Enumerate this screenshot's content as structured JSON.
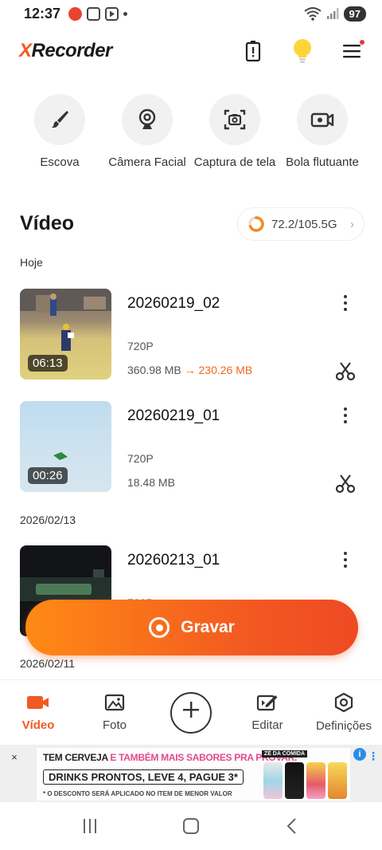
{
  "status_bar": {
    "time": "12:37",
    "battery": "97",
    "icons": [
      "notification-app-icon",
      "gallery-icon",
      "play-store-icon",
      "dot-icon",
      "wifi-icon",
      "signal-icon"
    ]
  },
  "header": {
    "logo_x": "X",
    "logo_rest": "Recorder",
    "brand_color": "#f15a22"
  },
  "tools": [
    {
      "label": "Escova",
      "icon": "brush-icon"
    },
    {
      "label": "Câmera Facial",
      "icon": "webcam-icon"
    },
    {
      "label": "Captura de tela",
      "icon": "screenshot-icon"
    },
    {
      "label": "Bola flutuante",
      "icon": "floating-ball-icon"
    }
  ],
  "section": {
    "title": "Vídeo",
    "storage": "72.2/105.5G",
    "storage_used_fraction": 0.684
  },
  "groups": [
    {
      "date": "Hoje"
    },
    {
      "date": "2026/02/13"
    },
    {
      "date": "2026/02/11"
    }
  ],
  "videos": [
    {
      "title": "20260219_02",
      "resolution": "720P",
      "size": "360.98 MB",
      "arrow": "→",
      "compressed": "230.26 MB",
      "duration": "06:13"
    },
    {
      "title": "20260219_01",
      "resolution": "720P",
      "size": "18.48 MB",
      "arrow": "",
      "compressed": "",
      "duration": "00:26"
    },
    {
      "title": "20260213_01",
      "resolution": "720P",
      "size": "",
      "arrow": "",
      "compressed": "",
      "duration": ""
    }
  ],
  "record_button": {
    "label": "Gravar"
  },
  "bottom_nav": [
    {
      "label": "Vídeo",
      "icon": "video-camera-icon",
      "active": true
    },
    {
      "label": "Foto",
      "icon": "photo-icon",
      "active": false
    },
    {
      "label": "",
      "icon": "plus-icon",
      "active": false
    },
    {
      "label": "Editar",
      "icon": "edit-icon",
      "active": false
    },
    {
      "label": "Definições",
      "icon": "settings-icon",
      "active": false
    }
  ],
  "ad": {
    "line1_a": "TEM CERVEJA ",
    "line1_b": "E TAMBÉM MAIS SABORES PRA PROVAR.",
    "line2": "DRINKS PRONTOS, LEVE 4, PAGUE 3*",
    "line3": "* O DESCONTO SERÁ APLICADO NO ITEM DE MENOR VALOR",
    "brand": "ZÉ DA COMIDA",
    "close": "×",
    "info": "i"
  }
}
